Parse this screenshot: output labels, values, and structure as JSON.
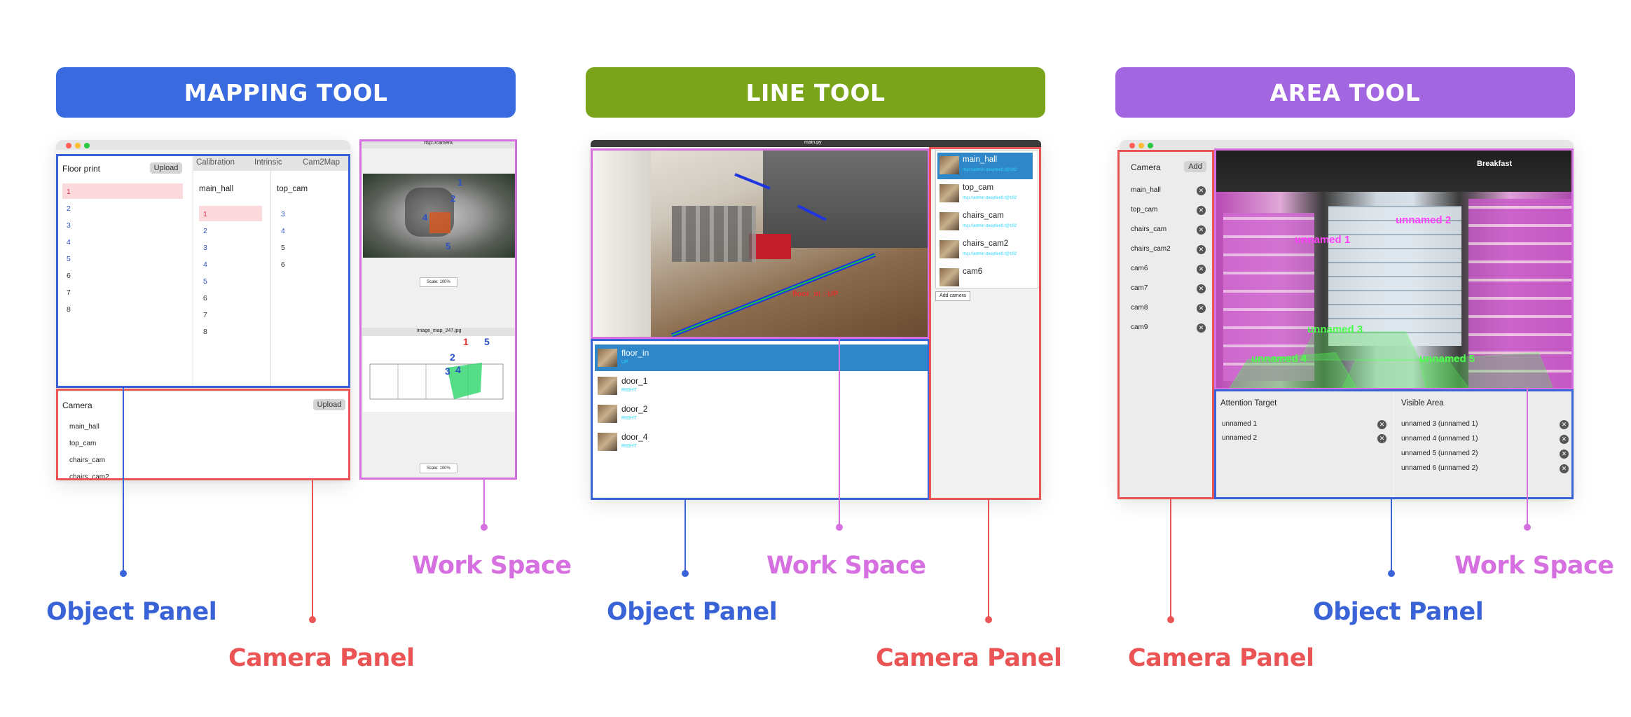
{
  "colors": {
    "blue": "#3a63d8",
    "red": "#ea5454",
    "pink": "#d670e0",
    "mapping": "#3a6ae0",
    "line": "#7aa51b",
    "area": "#a266e0"
  },
  "mapping": {
    "banner": "MAPPING TOOL",
    "floor_print": "Floor print",
    "upload": "Upload",
    "tabs": [
      "Calibration",
      "Intrinsic",
      "Cam2Map"
    ],
    "floor_items": [
      "1",
      "2",
      "3",
      "4",
      "5",
      "6",
      "7",
      "8"
    ],
    "col1_title": "main_hall",
    "col1_items": [
      "1",
      "2",
      "3",
      "4",
      "5",
      "6",
      "7",
      "8"
    ],
    "col2_title": "top_cam",
    "col2_items": [
      "3",
      "4",
      "5",
      "6"
    ],
    "camera_title": "Camera",
    "camera_upload": "Upload",
    "cameras": [
      "main_hall",
      "top_cam",
      "chairs_cam",
      "chairs_cam2"
    ],
    "ws1_title": "rtsp://camera",
    "ws2_title": "image_map_247.jpg",
    "scale1": "Scale: 100%",
    "scale2": "Scale: 100%",
    "cam_nums": [
      "1",
      "2",
      "3",
      "4",
      "5"
    ],
    "map_nums": [
      "1",
      "2",
      "3",
      "4",
      "5"
    ]
  },
  "line": {
    "banner": "LINE TOOL",
    "window_title": "main.py",
    "cameras": [
      {
        "name": "main_hall",
        "url": "rtsp://admin:deepfeel1!@192"
      },
      {
        "name": "top_cam",
        "url": "rtsp://admin:deepfeel1!@192"
      },
      {
        "name": "chairs_cam",
        "url": "rtsp://admin:deepfeel1!@192"
      },
      {
        "name": "chairs_cam2",
        "url": "rtsp://admin:deepfeel1!@192"
      },
      {
        "name": "cam6",
        "url": ""
      }
    ],
    "add_camera": "Add camera",
    "objects": [
      {
        "name": "floor_in",
        "sub": "UP"
      },
      {
        "name": "door_1",
        "sub": "RIGHT"
      },
      {
        "name": "door_2",
        "sub": "RIGHT"
      },
      {
        "name": "door_4",
        "sub": "RIGHT"
      }
    ],
    "overlay_labels": [
      "floor_in : UP"
    ]
  },
  "area": {
    "banner": "AREA TOOL",
    "camera_title": "Camera",
    "add": "Add",
    "cameras": [
      "main_hall",
      "top_cam",
      "chairs_cam",
      "chairs_cam2",
      "cam6",
      "cam7",
      "cam8",
      "cam9"
    ],
    "attention_title": "Attention Target",
    "attention_items": [
      "unnamed 1",
      "unnamed 2"
    ],
    "visible_title": "Visible Area",
    "visible_items": [
      "unnamed 3 (unnamed 1)",
      "unnamed 4 (unnamed 1)",
      "unnamed 5 (unnamed 2)",
      "unnamed 6 (unnamed 2)"
    ],
    "overlay": {
      "u1": "unnamed 1",
      "u2": "unnamed 2",
      "u3": "unnamed 3",
      "u4": "unnamed 4",
      "u5": "unnamed 5",
      "store": "Breakfast"
    }
  },
  "labels": {
    "object_panel": "Object Panel",
    "camera_panel": "Camera Panel",
    "work_space": "Work Space"
  }
}
